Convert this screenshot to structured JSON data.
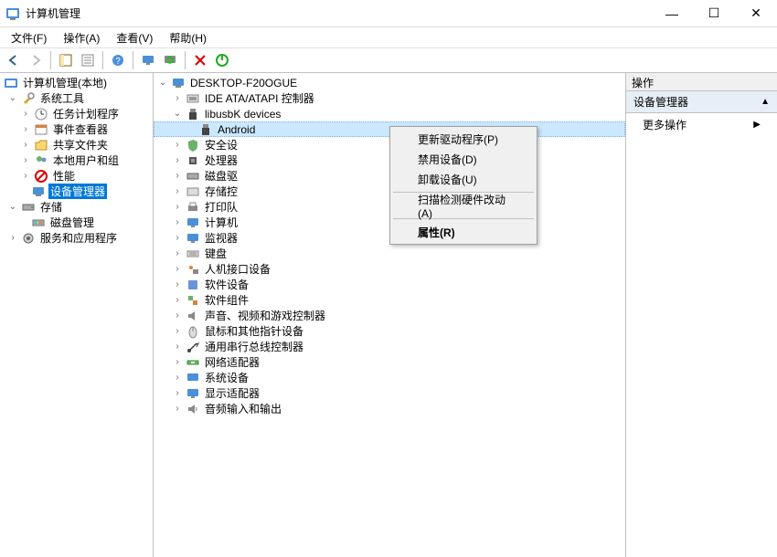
{
  "window": {
    "title": "计算机管理",
    "min": "—",
    "max": "☐",
    "close": "✕"
  },
  "menubar": {
    "file": "文件(F)",
    "action": "操作(A)",
    "view": "查看(V)",
    "help": "帮助(H)"
  },
  "left_tree": {
    "root": "计算机管理(本地)",
    "system_tools": "系统工具",
    "task_scheduler": "任务计划程序",
    "event_viewer": "事件查看器",
    "shared_folders": "共享文件夹",
    "local_users": "本地用户和组",
    "performance": "性能",
    "device_manager": "设备管理器",
    "storage": "存储",
    "disk_management": "磁盘管理",
    "services_apps": "服务和应用程序"
  },
  "mid_tree": {
    "root": "DESKTOP-F20OGUE",
    "ide": "IDE ATA/ATAPI 控制器",
    "libusbk": "libusbK devices",
    "android": "Android",
    "security": "安全设",
    "processor": "处理器",
    "disk_drive": "磁盘驱",
    "storage_ctrl": "存储控",
    "print_queue": "打印队",
    "computer": "计算机",
    "monitor": "监视器",
    "keyboard": "键盘",
    "hid": "人机接口设备",
    "software_dev": "软件设备",
    "software_comp": "软件组件",
    "sound": "声音、视频和游戏控制器",
    "mouse": "鼠标和其他指针设备",
    "usb": "通用串行总线控制器",
    "network": "网络适配器",
    "system_dev": "系统设备",
    "display": "显示适配器",
    "audio": "音频输入和输出"
  },
  "context_menu": {
    "update_driver": "更新驱动程序(P)",
    "disable": "禁用设备(D)",
    "uninstall": "卸载设备(U)",
    "scan": "扫描检测硬件改动(A)",
    "properties": "属性(R)"
  },
  "right_pane": {
    "header": "操作",
    "section": "设备管理器",
    "more": "更多操作"
  },
  "icons": {
    "chevron_right": "›",
    "chevron_down": "⌄"
  }
}
